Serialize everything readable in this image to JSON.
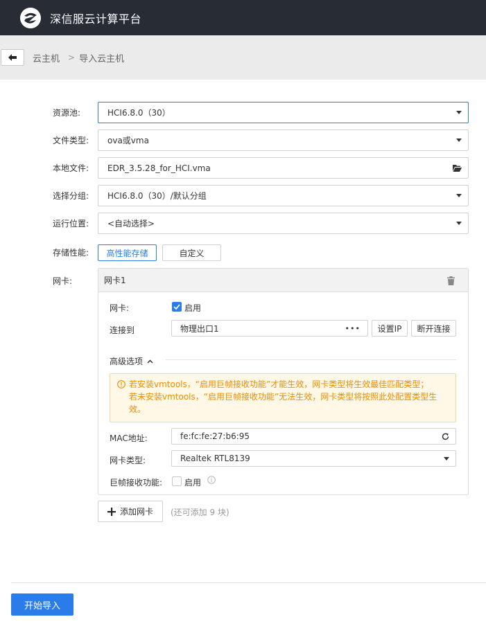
{
  "app": {
    "title": "深信服云计算平台"
  },
  "breadcrumb": {
    "parent": "云主机",
    "separator": ">",
    "current": "导入云主机"
  },
  "form": {
    "resource_pool": {
      "label": "资源池:",
      "value": "HCI6.8.0（30）"
    },
    "file_type": {
      "label": "文件类型:",
      "value": "ova或vma"
    },
    "local_file": {
      "label": "本地文件:",
      "value": "EDR_3.5.28_for_HCI.vma"
    },
    "group": {
      "label": "选择分组:",
      "value": "HCI6.8.0（30）/默认分组"
    },
    "run_location": {
      "label": "运行位置:",
      "value": "<自动选择>"
    },
    "storage": {
      "label": "存储性能:",
      "options": [
        "高性能存储",
        "自定义"
      ],
      "selected": "高性能存储"
    },
    "nic_label": "网卡:"
  },
  "nic": {
    "title": "网卡1",
    "enable_label": "网卡:",
    "enable_text": "启用",
    "enabled": true,
    "connect_label": "连接到",
    "connect_value": "物理出口1",
    "more": "•••",
    "set_ip": "设置IP",
    "disconnect": "断开连接",
    "advanced": "高级选项",
    "warning_line1": "若安装vmtools，“启用巨帧接收功能”才能生效，网卡类型将生效最佳匹配类型；",
    "warning_line2": "若未安装vmtools，“启用巨帧接收功能”无法生效，网卡类型将按照此处配置类型生效。",
    "mac_label": "MAC地址:",
    "mac_value": "fe:fc:fe:27:b6:95",
    "type_label": "网卡类型:",
    "type_value": "Realtek RTL8139",
    "jumbo_label": "巨帧接收功能:",
    "jumbo_text": "启用",
    "jumbo_enabled": false
  },
  "actions": {
    "add_nic": "添加网卡",
    "add_note": "(还可添加 9 块)",
    "start_import": "开始导入"
  },
  "colors": {
    "topbar": "#272c35",
    "accent": "#2a7ce8",
    "warning": "#f08c00"
  }
}
